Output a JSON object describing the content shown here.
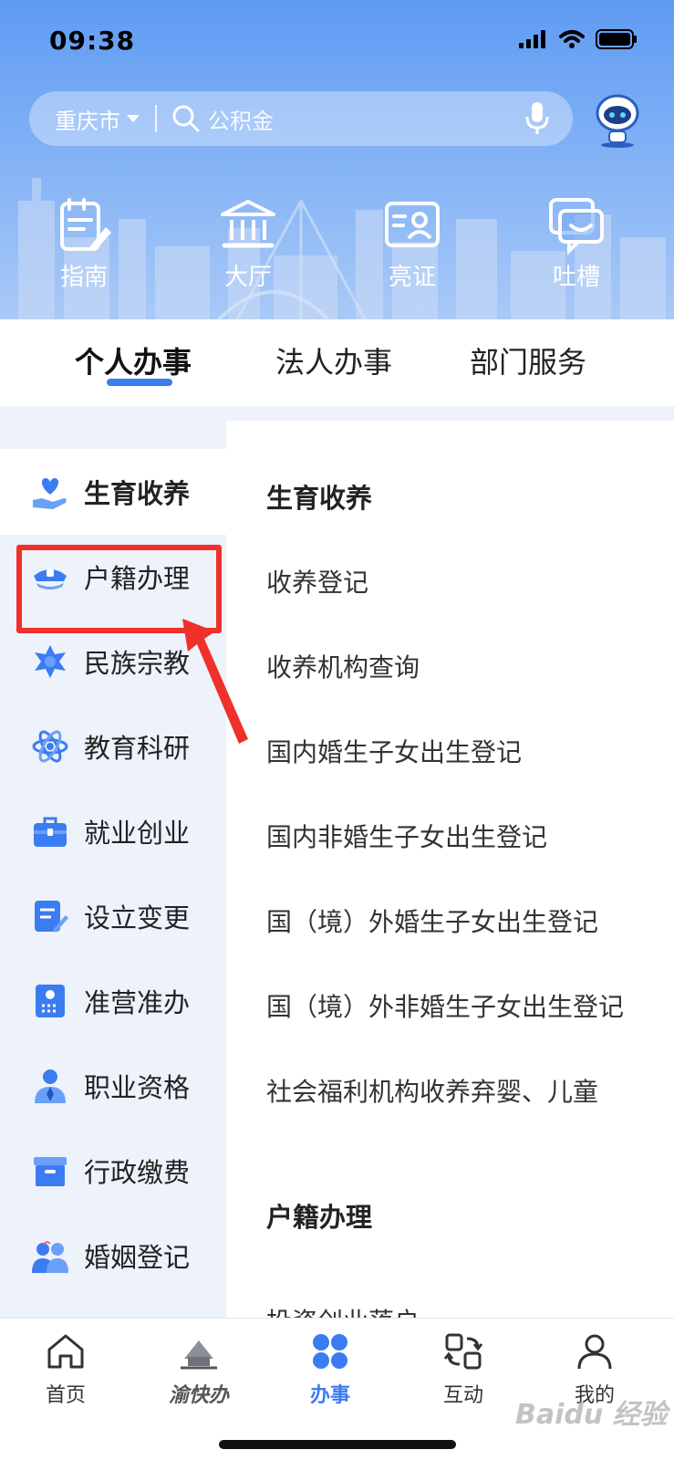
{
  "status_bar": {
    "time": "09:38"
  },
  "search": {
    "city": "重庆市",
    "placeholder": "公积金"
  },
  "quick_nav": [
    {
      "label": "指南",
      "icon": "guide-icon"
    },
    {
      "label": "大厅",
      "icon": "hall-icon"
    },
    {
      "label": "亮证",
      "icon": "id-card-icon"
    },
    {
      "label": "吐槽",
      "icon": "feedback-icon"
    }
  ],
  "tabs": [
    {
      "label": "个人办事",
      "active": true
    },
    {
      "label": "法人办事",
      "active": false
    },
    {
      "label": "部门服务",
      "active": false
    }
  ],
  "sidebar": {
    "items": [
      {
        "label": "生育收养",
        "icon": "hand-heart-icon",
        "selected": true
      },
      {
        "label": "户籍办理",
        "icon": "police-cap-icon",
        "selected": false
      },
      {
        "label": "民族宗教",
        "icon": "star-icon",
        "selected": false
      },
      {
        "label": "教育科研",
        "icon": "atom-icon",
        "selected": false
      },
      {
        "label": "就业创业",
        "icon": "briefcase-icon",
        "selected": false
      },
      {
        "label": "设立变更",
        "icon": "document-edit-icon",
        "selected": false
      },
      {
        "label": "准营准办",
        "icon": "license-icon",
        "selected": false
      },
      {
        "label": "职业资格",
        "icon": "person-tie-icon",
        "selected": false
      },
      {
        "label": "行政缴费",
        "icon": "archive-box-icon",
        "selected": false
      },
      {
        "label": "婚姻登记",
        "icon": "couple-icon",
        "selected": false
      }
    ]
  },
  "main": {
    "section1_title": "生育收养",
    "services": [
      "收养登记",
      "收养机构查询",
      "国内婚生子女出生登记",
      "国内非婚生子女出生登记",
      "国（境）外婚生子女出生登记",
      "国（境）外非婚生子女出生登记",
      "社会福利机构收养弃婴、儿童"
    ],
    "section2_title": "户籍办理",
    "partial_item": "投资创业落户"
  },
  "bottom_nav": [
    {
      "label": "首页",
      "icon": "home-icon",
      "active": false
    },
    {
      "label": "渝快办",
      "icon": "yukuaiban-logo-icon",
      "active": false
    },
    {
      "label": "办事",
      "icon": "grid-icon",
      "active": true
    },
    {
      "label": "互动",
      "icon": "exchange-icon",
      "active": false
    },
    {
      "label": "我的",
      "icon": "user-icon",
      "active": false
    }
  ],
  "watermark": "Baidu 经验",
  "colors": {
    "accent": "#3b7cf2",
    "highlight_box": "#f0302a",
    "header_top": "#5f9bf3"
  }
}
